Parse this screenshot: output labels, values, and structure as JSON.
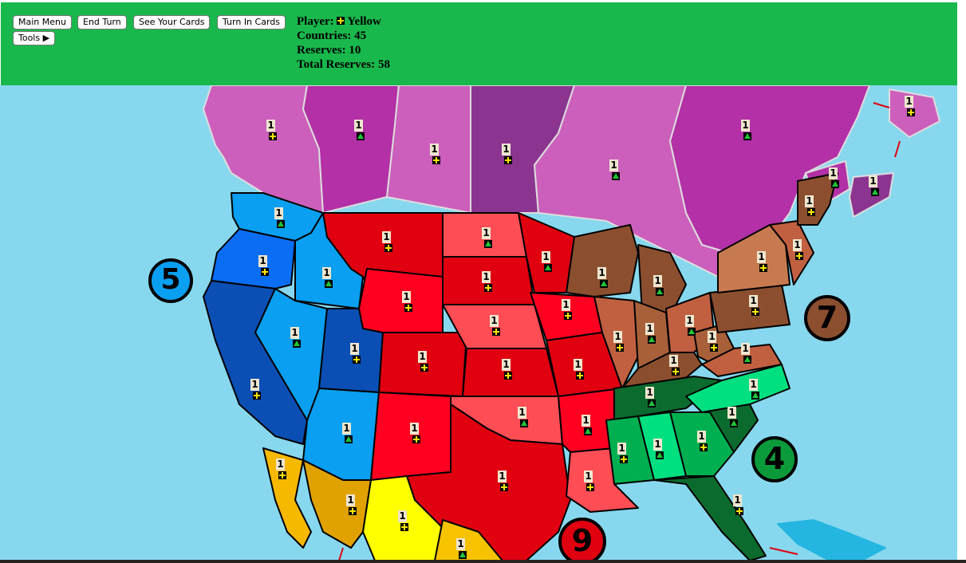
{
  "toolbar": {
    "main_menu": "Main Menu",
    "end_turn": "End Turn",
    "see_cards": "See Your Cards",
    "turn_in_cards": "Turn In Cards",
    "tools": "Tools ▶"
  },
  "player": {
    "label": "Player:",
    "name": "Yellow",
    "countries_label": "Countries:",
    "countries": "45",
    "reserves_label": "Reserves:",
    "reserves": "10",
    "total_reserves_label": "Total Reserves:",
    "total_reserves": "58"
  },
  "colors": {
    "header": "#19b84c",
    "ocean": "#87d8ee",
    "yellow_player": "#ffe600",
    "green_player": "#22c43a"
  },
  "regions": {
    "west_bonus": "5",
    "northeast_bonus": "7",
    "southeast_bonus": "4",
    "south_central_bonus": "9"
  },
  "armies": {
    "canada_yukon": "1",
    "canada_nwt": "1",
    "canada_alberta": "1",
    "canada_sask": "1",
    "canada_ontario": "1",
    "canada_quebec": "1",
    "newfoundland": "1",
    "new_brunswick": "1",
    "nova_scotia": "1",
    "washington": "1",
    "oregon": "1",
    "idaho": "1",
    "california": "1",
    "nevada": "1",
    "utah": "1",
    "arizona": "1",
    "montana": "1",
    "wyoming": "1",
    "colorado": "1",
    "new_mexico": "1",
    "north_dakota": "1",
    "south_dakota": "1",
    "nebraska": "1",
    "kansas": "1",
    "oklahoma": "1",
    "texas": "1",
    "minnesota": "1",
    "iowa": "1",
    "missouri": "1",
    "arkansas": "1",
    "louisiana": "1",
    "wisconsin": "1",
    "michigan": "1",
    "illinois": "1",
    "indiana": "1",
    "ohio": "1",
    "kentucky": "1",
    "west_virginia": "1",
    "virginia": "1",
    "pennsylvania": "1",
    "new_york": "1",
    "vermont": "1",
    "maine": "1",
    "tennessee": "1",
    "north_carolina": "1",
    "south_carolina": "1",
    "georgia": "1",
    "alabama": "1",
    "mississippi": "1",
    "florida": "1",
    "baja": "1",
    "sonora": "1",
    "chihuahua": "1",
    "coahuila": "1"
  },
  "owners": {
    "canada_yukon": "yellow",
    "canada_nwt": "green",
    "canada_alberta": "yellow",
    "canada_sask": "yellow",
    "canada_ontario": "green",
    "canada_quebec": "green",
    "newfoundland": "yellow",
    "new_brunswick": "green",
    "nova_scotia": "green",
    "washington": "green",
    "oregon": "yellow",
    "idaho": "green",
    "california": "yellow",
    "nevada": "green",
    "utah": "yellow",
    "arizona": "green",
    "montana": "yellow",
    "wyoming": "yellow",
    "colorado": "yellow",
    "new_mexico": "yellow",
    "north_dakota": "green",
    "south_dakota": "yellow",
    "nebraska": "yellow",
    "kansas": "yellow",
    "oklahoma": "green",
    "texas": "yellow",
    "minnesota": "green",
    "iowa": "yellow",
    "missouri": "yellow",
    "arkansas": "green",
    "louisiana": "yellow",
    "wisconsin": "green",
    "michigan": "green",
    "illinois": "yellow",
    "indiana": "green",
    "ohio": "green",
    "kentucky": "yellow",
    "west_virginia": "yellow",
    "virginia": "green",
    "pennsylvania": "yellow",
    "new_york": "yellow",
    "vermont": "yellow",
    "maine": "yellow",
    "tennessee": "green",
    "north_carolina": "green",
    "south_carolina": "green",
    "georgia": "yellow",
    "alabama": "green",
    "mississippi": "yellow",
    "florida": "yellow",
    "baja": "yellow",
    "sonora": "yellow",
    "chihuahua": "yellow",
    "coahuila": "green"
  }
}
